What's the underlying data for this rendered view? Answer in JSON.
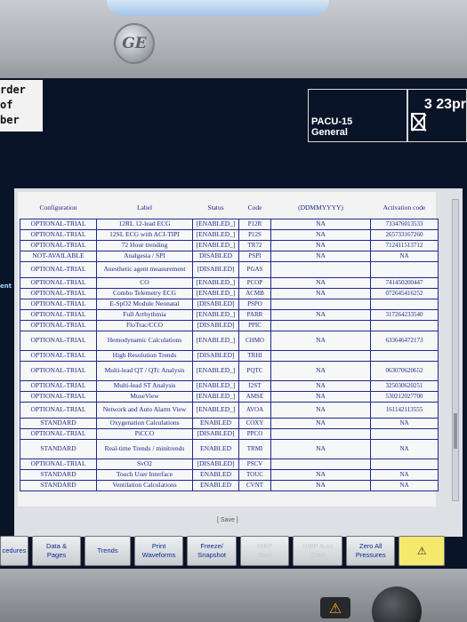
{
  "header": {
    "left_text": [
      "rder",
      "of",
      "ber"
    ],
    "patient": [
      "PACU-15",
      "General"
    ],
    "clock": "3 23pr"
  },
  "side_note": "ent",
  "table": {
    "columns": [
      "Configuration",
      "Label",
      "Status",
      "Code",
      "(DDMMYYYY)",
      "Activation code"
    ],
    "rows": [
      {
        "cfg": "OPTIONAL-TRIAL",
        "label": "12RL 12-lead ECG",
        "status": "[ENABLED_]",
        "code": "P12R",
        "date": "NA",
        "act": "733476013533"
      },
      {
        "cfg": "OPTIONAL-TRIAL",
        "label": "12SL ECG with ACI-TIPI",
        "status": "[ENABLED_]",
        "code": "P12S",
        "date": "NA",
        "act": "265733167260"
      },
      {
        "cfg": "OPTIONAL-TRIAL",
        "label": "72 Hour trending",
        "status": "[ENABLED_]",
        "code": "TR72",
        "date": "NA",
        "act": "712411513712"
      },
      {
        "cfg": "NOT-AVAILABLE",
        "label": "Analgesia / SPI",
        "status": "DISABLED",
        "code": "PSPI",
        "date": "NA",
        "act": "NA"
      },
      {
        "cfg": "OPTIONAL-TRIAL",
        "label": "Anesthetic agent measurement",
        "status": "[DISABLED]",
        "code": "PGAS",
        "date": "",
        "act": "",
        "tall": true
      },
      {
        "cfg": "OPTIONAL-TRIAL",
        "label": "CO",
        "status": "[ENABLED_]",
        "code": "PCOP",
        "date": "NA",
        "act": "741450200447"
      },
      {
        "cfg": "OPTIONAL-TRIAL",
        "label": "Combo Telemetry ECG",
        "status": "[ENABLED_]",
        "code": "ACMB",
        "date": "NA",
        "act": "072645416252"
      },
      {
        "cfg": "OPTIONAL-TRIAL",
        "label": "E-SpO2 Module Neonatal",
        "status": "[DISABLED]",
        "code": "PSPO",
        "date": "",
        "act": ""
      },
      {
        "cfg": "OPTIONAL-TRIAL",
        "label": "Full Arrhythmia",
        "status": "[ENABLED_]",
        "code": "PARR",
        "date": "NA",
        "act": "317264233540"
      },
      {
        "cfg": "OPTIONAL-TRIAL",
        "label": "FloTrac/CCO",
        "status": "[DISABLED]",
        "code": "PPIC",
        "date": "",
        "act": ""
      },
      {
        "cfg": "OPTIONAL-TRIAL",
        "label": "Hemodynamic Calculations",
        "status": "[ENABLED_]",
        "code": "CHMO",
        "date": "NA",
        "act": "633646472173",
        "xtall": true
      },
      {
        "cfg": "OPTIONAL-TRIAL",
        "label": "High Resolution Trends",
        "status": "[DISABLED]",
        "code": "TRHI",
        "date": "",
        "act": ""
      },
      {
        "cfg": "OPTIONAL-TRIAL",
        "label": "Multi-lead QT / QTc Analysis",
        "status": "[ENABLED_]",
        "code": "PQTC",
        "date": "NA",
        "act": "063070620652",
        "xtall": true
      },
      {
        "cfg": "OPTIONAL-TRIAL",
        "label": "Multi-lead ST Analysis",
        "status": "[ENABLED_]",
        "code": "I2ST",
        "date": "NA",
        "act": "325030620251"
      },
      {
        "cfg": "OPTIONAL-TRIAL",
        "label": "MuseView",
        "status": "[ENABLED_]",
        "code": "AMSE",
        "date": "NA",
        "act": "530212027700"
      },
      {
        "cfg": "OPTIONAL-TRIAL",
        "label": "Network and Auto Alarm View",
        "status": "[ENABLED_]",
        "code": "AVOA",
        "date": "NA",
        "act": "161142113555",
        "tall": true
      },
      {
        "cfg": "STANDARD",
        "label": "Oxygenation Calculations",
        "status": "ENABLED",
        "code": "COXY",
        "date": "NA",
        "act": "NA"
      },
      {
        "cfg": "OPTIONAL-TRIAL",
        "label": "PiCCO",
        "status": "[DISABLED]",
        "code": "PPCO",
        "date": "",
        "act": ""
      },
      {
        "cfg": "STANDARD",
        "label": "Real-time Trends / minitrends",
        "status": "ENABLED",
        "code": "TRMI",
        "date": "NA",
        "act": "NA",
        "xtall": true
      },
      {
        "cfg": "OPTIONAL-TRIAL",
        "label": "SvO2",
        "status": "[DISABLED]",
        "code": "PSCV",
        "date": "",
        "act": ""
      },
      {
        "cfg": "STANDARD",
        "label": "Touch User Interface",
        "status": "ENABLED",
        "code": "TOUC",
        "date": "NA",
        "act": "NA"
      },
      {
        "cfg": "STANDARD",
        "label": "Ventilation Calculations",
        "status": "ENABLED",
        "code": "CVNT",
        "date": "NA",
        "act": "NA"
      }
    ]
  },
  "save_label": "[ Save ]",
  "buttons": [
    {
      "name": "procedures-button",
      "label": "cedures",
      "w": 32,
      "dis": false
    },
    {
      "name": "data-pages-button",
      "label": "Data &\nPages",
      "w": 56,
      "dis": false
    },
    {
      "name": "trends-button",
      "label": "Trends",
      "w": 52,
      "dis": false
    },
    {
      "name": "print-waveforms-button",
      "label": "Print\nWaveforms",
      "w": 56,
      "dis": false
    },
    {
      "name": "freeze-snapshot-button",
      "label": "Freeze/\nSnapshot",
      "w": 56,
      "dis": false
    },
    {
      "name": "nibp-start-button",
      "label": "NIBP\nStart",
      "w": 56,
      "dis": true
    },
    {
      "name": "nibp-auto-start-button",
      "label": "NIBP Auto\nStart",
      "w": 56,
      "dis": true
    },
    {
      "name": "zero-all-pressures-button",
      "label": "Zero All\nPressures",
      "w": 56,
      "dis": false
    },
    {
      "name": "alarm-pause-button",
      "label": "⚠",
      "w": 52,
      "dis": false,
      "alarm": true
    }
  ],
  "led_icon": "⚠"
}
